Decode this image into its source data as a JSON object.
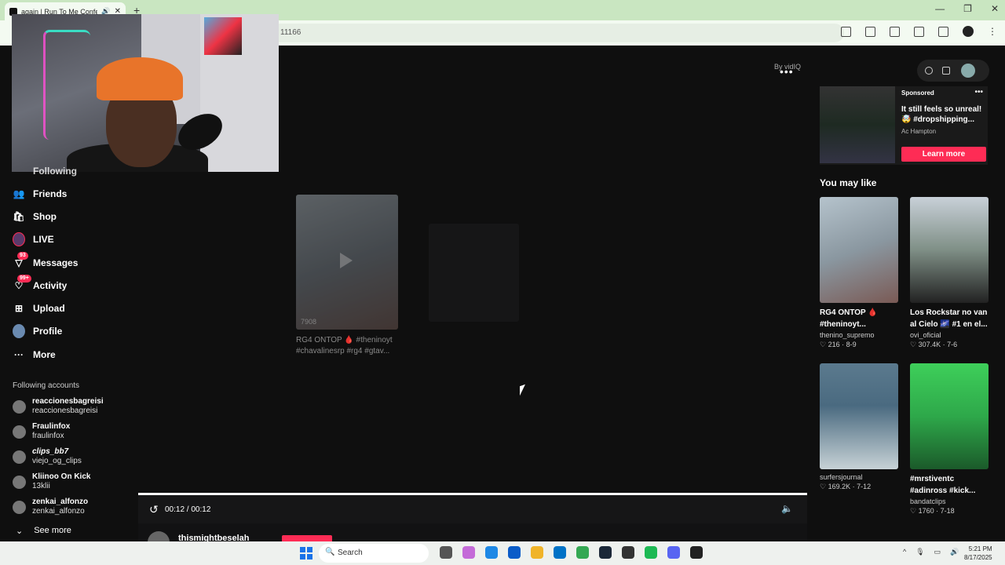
{
  "browser": {
    "tab_title": "again | Run To Me Confess",
    "url_fragment": "11166",
    "close": "✕",
    "new_tab": "+",
    "window_controls": [
      "—",
      "❐",
      "✕"
    ]
  },
  "sidebar": {
    "partial_item": "Following",
    "items": [
      {
        "label": "Friends",
        "icon": "friends-icon"
      },
      {
        "label": "Shop",
        "icon": "shop-icon"
      },
      {
        "label": "LIVE",
        "icon": "live-icon"
      },
      {
        "label": "Messages",
        "icon": "messages-icon",
        "badge": "93"
      },
      {
        "label": "Activity",
        "icon": "activity-icon",
        "badge": "99+"
      },
      {
        "label": "Upload",
        "icon": "upload-icon"
      },
      {
        "label": "Profile",
        "icon": "profile-icon"
      },
      {
        "label": "More",
        "icon": "more-icon"
      }
    ],
    "following_title": "Following accounts",
    "accounts": [
      {
        "name": "reaccionesbagreisi",
        "handle": "reaccionesbagreisi"
      },
      {
        "name": "Fraulinfox",
        "handle": "fraulinfox"
      },
      {
        "name": "clips_bb7",
        "handle": "viejo_og_clips"
      },
      {
        "name": "Kliinoo On Kick",
        "handle": "13klii"
      },
      {
        "name": "zenkai_alfonzo",
        "handle": "zenkai_alfonzo"
      }
    ],
    "see_more": "See more"
  },
  "center": {
    "by": "By vidIQ",
    "thumb_count": "7908",
    "thumb_caption": "RG4 ONTOP 🩸 #theninoyt #chavalinesrp #rg4 #gtav...",
    "time": "00:12 / 00:12",
    "username": "thismightbeselah"
  },
  "ad": {
    "label": "Sponsored",
    "headline": "It still feels so unreal! 🤯 #dropshipping...",
    "advertiser": "Ac Hampton",
    "cta": "Learn more"
  },
  "you_may_like": {
    "title": "You may like",
    "cards": [
      {
        "caption": "RG4 ONTOP 🩸 #theninoyt...",
        "author": "thenino_supremo",
        "stats": "♡ 216 · 8-9",
        "color": "#8a97a0"
      },
      {
        "caption": "Los Rockstar no van al Cielo 🌌 #1 en el...",
        "author": "ovi_oficial",
        "stats": "♡ 307.4K · 7-6",
        "color": "#7f8f86"
      },
      {
        "caption": "",
        "author": "surfersjournal",
        "stats": "♡ 169.2K · 7-12",
        "color": "#4a6a80"
      },
      {
        "caption": "#mrstiventc #adinross #kick...",
        "author": "bandatclips",
        "stats": "♡ 1760 · 7-18",
        "color": "#2ea84a"
      }
    ]
  },
  "taskbar": {
    "search": "Search",
    "time": "5:21 PM",
    "date": "8/17/2025"
  }
}
